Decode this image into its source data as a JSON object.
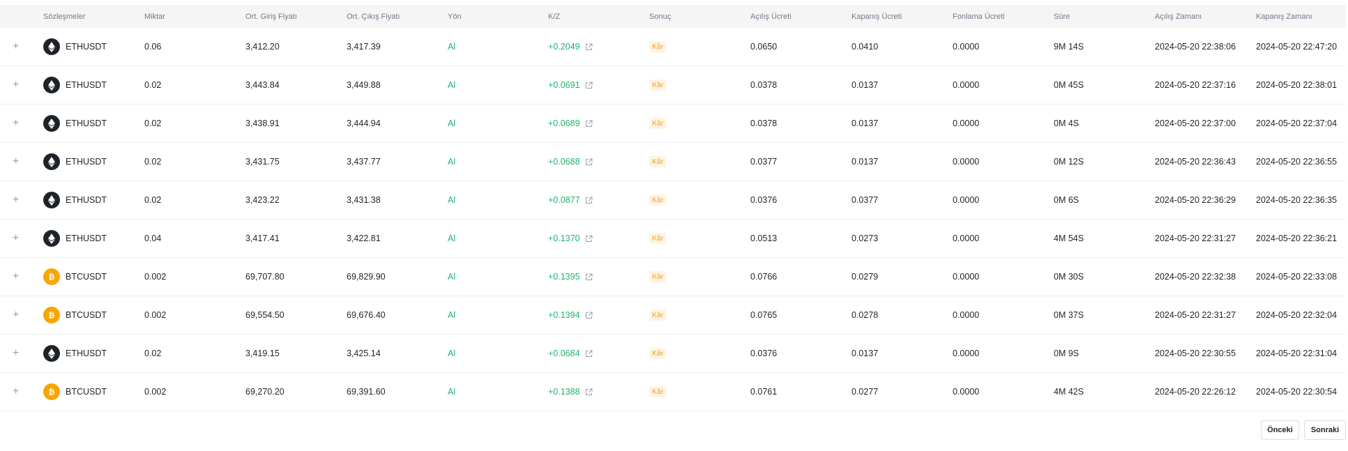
{
  "columns": {
    "symbol": "Sözleşmeler",
    "qty": "Miktar",
    "entry": "Ort. Giriş Fiyatı",
    "exit": "Ort. Çıkış Fiyatı",
    "side": "Yön",
    "pnl": "K/Z",
    "result": "Sonuç",
    "open_fee": "Açılış Ücreti",
    "close_fee": "Kapanış Ücreti",
    "funding": "Fonlama Ücreti",
    "duration": "Süre",
    "open_time": "Açılış Zamanı",
    "close_time": "Kapanış Zamanı"
  },
  "expand_symbol": "+",
  "icons": {
    "expand": "plus-icon",
    "eth": "ethereum-icon",
    "btc": "bitcoin-icon",
    "pnl_link": "external-link-icon"
  },
  "colors": {
    "eth_coin": "#1e2329",
    "btc_coin": "#f7a600",
    "profit": "#20b26c",
    "badge_text": "#f0a02a",
    "badge_bg": "#fff3e2"
  },
  "rows": [
    {
      "coin": "eth",
      "symbol": "ETHUSDT",
      "qty": "0.06",
      "entry": "3,412.20",
      "exit": "3,417.39",
      "side": "Al",
      "pnl": "+0.2049",
      "result": "Kâr",
      "open_fee": "0.0650",
      "close_fee": "0.0410",
      "funding": "0.0000",
      "duration": "9M 14S",
      "open_time": "2024-05-20 22:38:06",
      "close_time": "2024-05-20 22:47:20"
    },
    {
      "coin": "eth",
      "symbol": "ETHUSDT",
      "qty": "0.02",
      "entry": "3,443.84",
      "exit": "3,449.88",
      "side": "Al",
      "pnl": "+0.0691",
      "result": "Kâr",
      "open_fee": "0.0378",
      "close_fee": "0.0137",
      "funding": "0.0000",
      "duration": "0M 45S",
      "open_time": "2024-05-20 22:37:16",
      "close_time": "2024-05-20 22:38:01"
    },
    {
      "coin": "eth",
      "symbol": "ETHUSDT",
      "qty": "0.02",
      "entry": "3,438.91",
      "exit": "3,444.94",
      "side": "Al",
      "pnl": "+0.0689",
      "result": "Kâr",
      "open_fee": "0.0378",
      "close_fee": "0.0137",
      "funding": "0.0000",
      "duration": "0M 4S",
      "open_time": "2024-05-20 22:37:00",
      "close_time": "2024-05-20 22:37:04"
    },
    {
      "coin": "eth",
      "symbol": "ETHUSDT",
      "qty": "0.02",
      "entry": "3,431.75",
      "exit": "3,437.77",
      "side": "Al",
      "pnl": "+0.0688",
      "result": "Kâr",
      "open_fee": "0.0377",
      "close_fee": "0.0137",
      "funding": "0.0000",
      "duration": "0M 12S",
      "open_time": "2024-05-20 22:36:43",
      "close_time": "2024-05-20 22:36:55"
    },
    {
      "coin": "eth",
      "symbol": "ETHUSDT",
      "qty": "0.02",
      "entry": "3,423.22",
      "exit": "3,431.38",
      "side": "Al",
      "pnl": "+0.0877",
      "result": "Kâr",
      "open_fee": "0.0376",
      "close_fee": "0.0377",
      "funding": "0.0000",
      "duration": "0M 6S",
      "open_time": "2024-05-20 22:36:29",
      "close_time": "2024-05-20 22:36:35"
    },
    {
      "coin": "eth",
      "symbol": "ETHUSDT",
      "qty": "0.04",
      "entry": "3,417.41",
      "exit": "3,422.81",
      "side": "Al",
      "pnl": "+0.1370",
      "result": "Kâr",
      "open_fee": "0.0513",
      "close_fee": "0.0273",
      "funding": "0.0000",
      "duration": "4M 54S",
      "open_time": "2024-05-20 22:31:27",
      "close_time": "2024-05-20 22:36:21"
    },
    {
      "coin": "btc",
      "symbol": "BTCUSDT",
      "qty": "0.002",
      "entry": "69,707.80",
      "exit": "69,829.90",
      "side": "Al",
      "pnl": "+0.1395",
      "result": "Kâr",
      "open_fee": "0.0766",
      "close_fee": "0.0279",
      "funding": "0.0000",
      "duration": "0M 30S",
      "open_time": "2024-05-20 22:32:38",
      "close_time": "2024-05-20 22:33:08"
    },
    {
      "coin": "btc",
      "symbol": "BTCUSDT",
      "qty": "0.002",
      "entry": "69,554.50",
      "exit": "69,676.40",
      "side": "Al",
      "pnl": "+0.1394",
      "result": "Kâr",
      "open_fee": "0.0765",
      "close_fee": "0.0278",
      "funding": "0.0000",
      "duration": "0M 37S",
      "open_time": "2024-05-20 22:31:27",
      "close_time": "2024-05-20 22:32:04"
    },
    {
      "coin": "eth",
      "symbol": "ETHUSDT",
      "qty": "0.02",
      "entry": "3,419.15",
      "exit": "3,425.14",
      "side": "Al",
      "pnl": "+0.0684",
      "result": "Kâr",
      "open_fee": "0.0376",
      "close_fee": "0.0137",
      "funding": "0.0000",
      "duration": "0M 9S",
      "open_time": "2024-05-20 22:30:55",
      "close_time": "2024-05-20 22:31:04"
    },
    {
      "coin": "btc",
      "symbol": "BTCUSDT",
      "qty": "0.002",
      "entry": "69,270.20",
      "exit": "69,391.60",
      "side": "Al",
      "pnl": "+0.1388",
      "result": "Kâr",
      "open_fee": "0.0761",
      "close_fee": "0.0277",
      "funding": "0.0000",
      "duration": "4M 42S",
      "open_time": "2024-05-20 22:26:12",
      "close_time": "2024-05-20 22:30:54"
    }
  ],
  "pagination": {
    "prev_label": "Önceki",
    "next_label": "Sonraki"
  }
}
